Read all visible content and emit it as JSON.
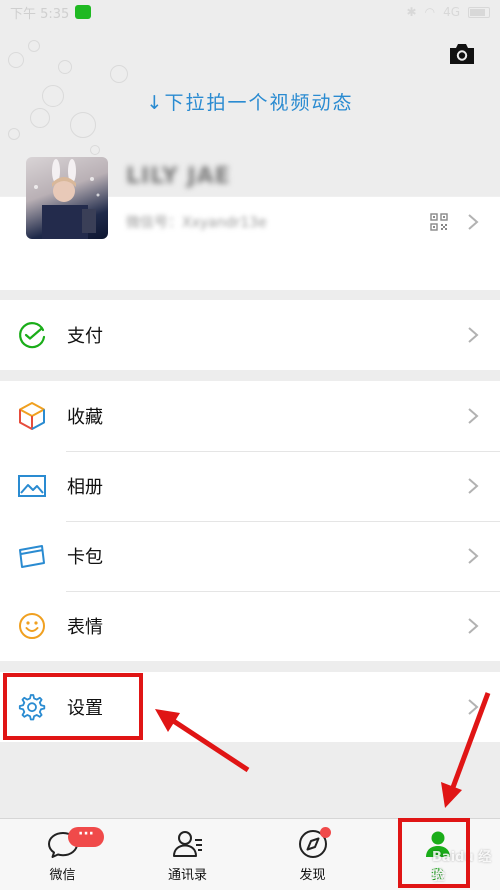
{
  "status_bar": {
    "time": "下午 5:35",
    "network": "4G"
  },
  "header": {
    "pull_hint": "↓下拉拍一个视频动态"
  },
  "profile": {
    "name": "LILY JAE",
    "wechat_id": "微信号：Xxyandr13e"
  },
  "menu": {
    "pay": {
      "label": "支付",
      "icon": "wechat-pay-icon"
    },
    "items": [
      {
        "label": "收藏",
        "icon": "favorites-cube-icon"
      },
      {
        "label": "相册",
        "icon": "album-picture-icon"
      },
      {
        "label": "卡包",
        "icon": "card-wallet-icon"
      },
      {
        "label": "表情",
        "icon": "smiley-icon"
      }
    ],
    "settings": {
      "label": "设置",
      "icon": "gear-icon"
    }
  },
  "tabbar": {
    "tabs": [
      {
        "label": "微信",
        "badge": "···"
      },
      {
        "label": "通讯录"
      },
      {
        "label": "发现"
      },
      {
        "label": "我"
      }
    ],
    "active_tab": "我"
  },
  "watermark": "Baidu 经验",
  "colors": {
    "accent_green": "#1aad19",
    "link_blue": "#2a8bd1",
    "badge_red": "#f04a4a",
    "annotation_red": "#e01515"
  }
}
